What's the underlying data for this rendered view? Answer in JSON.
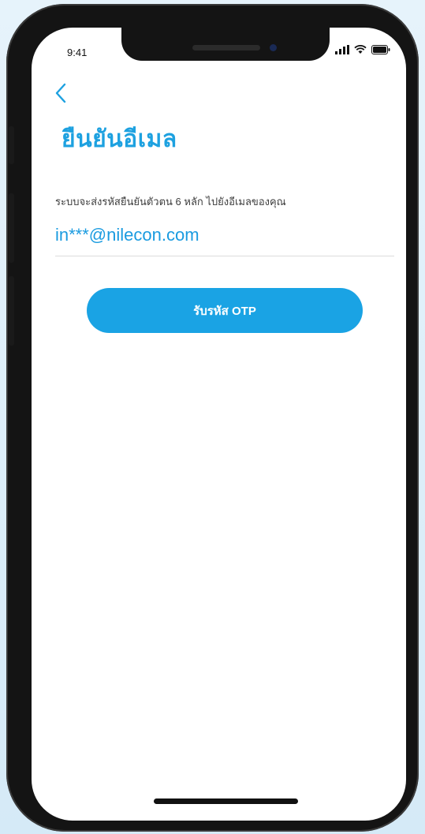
{
  "status_bar": {
    "time": "9:41",
    "icons": [
      "signal-icon",
      "wifi-icon",
      "battery-icon"
    ]
  },
  "navigation": {
    "back_icon": "chevron-left-icon"
  },
  "page": {
    "title": "ยืนยันอีเมล",
    "description": "ระบบจะส่งรหัสยืนยันตัวตน 6 หลัก ไปยังอีเมลของคุณ",
    "email": "in***@nilecon.com"
  },
  "actions": {
    "request_otp_label": "รับรหัส OTP"
  },
  "colors": {
    "accent": "#1da1e0",
    "button": "#1aa3e4",
    "background": "#ffffff"
  }
}
